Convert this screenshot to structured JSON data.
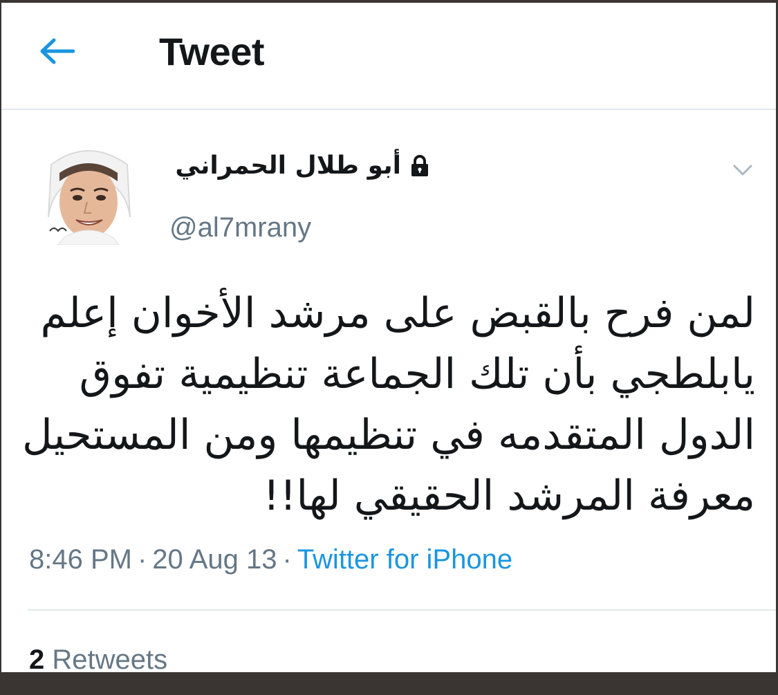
{
  "header": {
    "title": "Tweet",
    "back_icon": "arrow-left-icon"
  },
  "user": {
    "name": "أبو طلال الحمراني",
    "handle": "@al7mrany",
    "protected_icon": "lock-icon",
    "menu_icon": "chevron-down-icon"
  },
  "tweet": {
    "lines": [
      "لمن فرح بالقبض على مرشد الأخوان إعلم",
      "يابلطجي بأن تلك الجماعة تنظيمية تفوق",
      "الدول المتقدمه في تنظيمها ومن المستحيل",
      "معرفة المرشد الحقيقي لها!!"
    ]
  },
  "meta": {
    "time": "8:46 PM",
    "separator": "·",
    "date": "20 Aug 13",
    "source": "Twitter for iPhone"
  },
  "stats": {
    "retweets_count": "2",
    "retweets_label": "Retweets"
  },
  "colors": {
    "accent": "#1b95e0",
    "text": "#14171a",
    "secondary": "#657786",
    "divider": "#e1e8ed"
  }
}
